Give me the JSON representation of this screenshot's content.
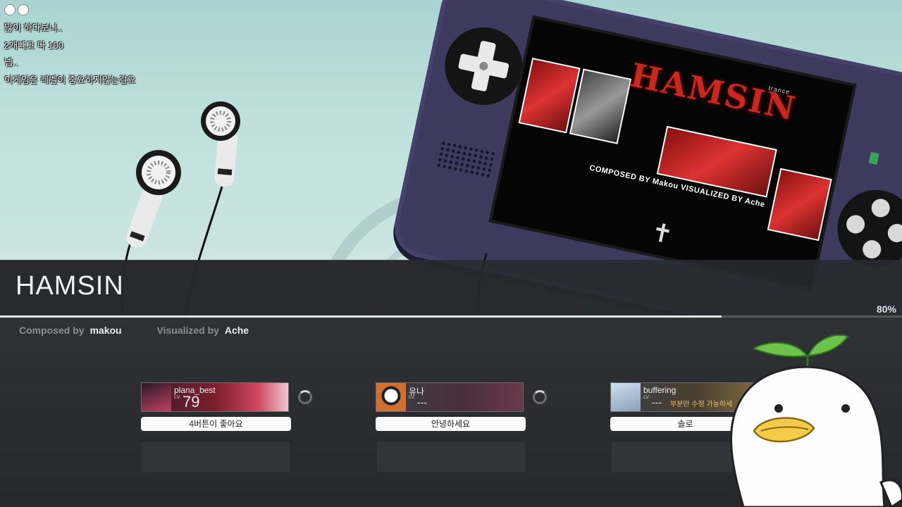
{
  "chat": {
    "lines": [
      "많이 하다보니..",
      "2개빼고 다 100",
      "넵..",
      "이게임은 레벨이 중요하지않는걸요"
    ]
  },
  "artwork": {
    "title": "HAMSIN",
    "tag": "trance",
    "credit": "COMPOSED BY Makou  VISUALIZED BY Ache"
  },
  "song": {
    "title": "HAMSIN",
    "progress": 0.8,
    "progress_label": "80%",
    "composed_label": "Composed by",
    "composer": "makou",
    "visualized_label": "Visualized by",
    "visualizer": "Ache"
  },
  "players": [
    {
      "name": "plana_best",
      "lv_label": "LV.",
      "level": "79",
      "note": "",
      "message": "4버튼이 좋아요"
    },
    {
      "name": "유나",
      "lv_label": "LV.",
      "level": "---",
      "note": "",
      "message": "안녕하세요"
    },
    {
      "name": "buffering",
      "lv_label": "LV.",
      "level": "---",
      "note": "부분만 수정 가능하세",
      "message": "솔로"
    }
  ],
  "colors": {
    "accent_red": "#c8281e",
    "console_body": "#3d3a5e",
    "band": "#282a2e"
  }
}
